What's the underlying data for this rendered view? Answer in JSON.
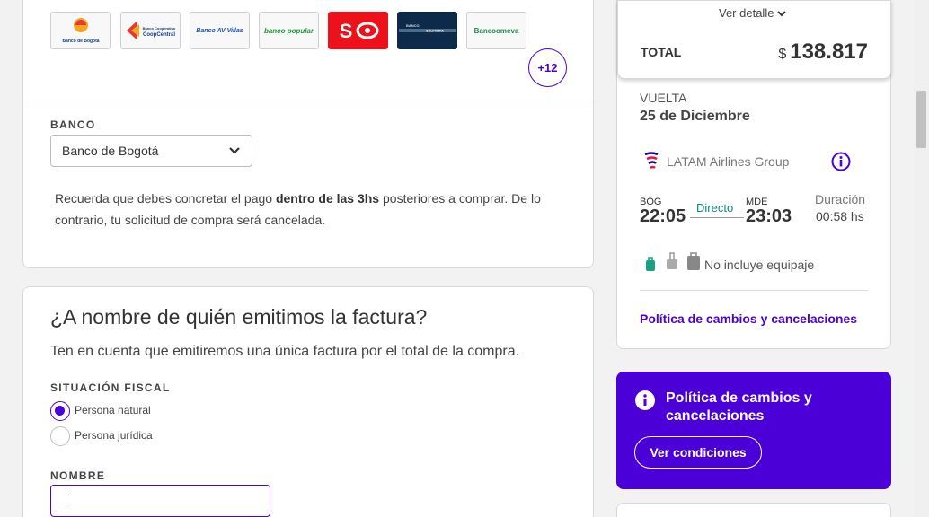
{
  "payment": {
    "banks": [
      {
        "name": "Banco de Bogotá",
        "color": "#0a3d8f"
      },
      {
        "name": "Banco Cooperativo CoopCentral",
        "color": "#1a3b8a"
      },
      {
        "name": "Banco AV Villas",
        "color": "#1b4fb3"
      },
      {
        "name": "banco popular",
        "color": "#1a9b3a"
      },
      {
        "name": "Scotiabank",
        "color": "#ec111a"
      },
      {
        "name": "Colpatria",
        "color": "#0e2a4a"
      },
      {
        "name": "Bancoomeva",
        "color": "#1c8a4a"
      }
    ],
    "more_banks": "+12",
    "bank_label": "BANCO",
    "bank_selected": "Banco de Bogotá",
    "note_pre": "Recuerda que debes concretar el pago ",
    "note_bold": "dentro de las 3hs",
    "note_post": " posteriores a comprar. De lo contrario, tu solicitud de compra será cancelada."
  },
  "invoice": {
    "title": "¿A nombre de quién emitimos la factura?",
    "subtitle": "Ten en cuenta que emitiremos una única factura por el total de la compra.",
    "fiscal_label": "SITUACIÓN FISCAL",
    "options": [
      "Persona natural",
      "Persona jurídica"
    ],
    "name_label": "NOMBRE",
    "name_value": ""
  },
  "summary": {
    "ver_detalle": "Ver detalle",
    "total_label": "TOTAL",
    "currency": "$",
    "total_value": "138.817",
    "leg_label": "VUELTA",
    "leg_date": "25 de Diciembre",
    "airline": "LATAM Airlines Group",
    "origin": "BOG",
    "origin_time": "22:05",
    "stops": "Directo",
    "destination": "MDE",
    "destination_time": "23:03",
    "duration_label": "Duración",
    "duration_value": "00:58 hs",
    "baggage": "No incluye equipaje",
    "policy_link": "Política de cambios y cancelaciones"
  },
  "promo": {
    "title": "Política de cambios y cancelaciones",
    "button": "Ver condiciones"
  },
  "colors": {
    "accent": "#4a00d6",
    "direct": "#0a8a7a"
  }
}
